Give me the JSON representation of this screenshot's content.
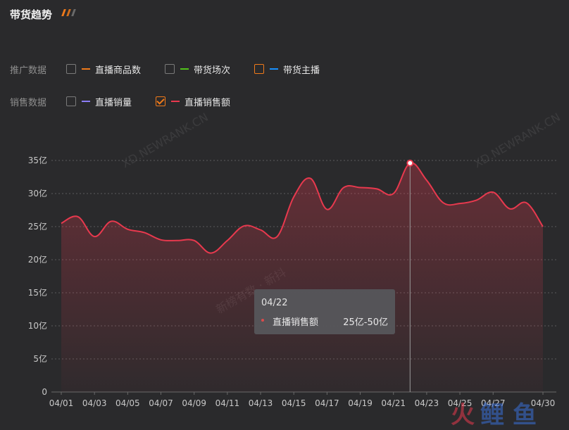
{
  "header": {
    "title": "带货趋势"
  },
  "filters": {
    "rows": [
      {
        "label": "推广数据",
        "options": [
          {
            "text": "直播商品数",
            "checked": false,
            "color": "#f07a1a"
          },
          {
            "text": "带货场次",
            "checked": false,
            "color": "#52c41a"
          },
          {
            "text": "带货主播",
            "checked": false,
            "color": "#1890ff",
            "highlight": true
          }
        ]
      },
      {
        "label": "销售数据",
        "options": [
          {
            "text": "直播销量",
            "checked": false,
            "color": "#8b7cf6"
          },
          {
            "text": "直播销售额",
            "checked": true,
            "color": "#e8394e"
          }
        ]
      }
    ]
  },
  "watermarks": [
    "XD.NEWRANK.CN",
    "XD.NEWRANK.CN",
    "新榜有数 · 新抖"
  ],
  "tooltip": {
    "date": "04/22",
    "series": "直播销售额",
    "value": "25亿-50亿"
  },
  "brand": {
    "chars": [
      "火",
      "鲤",
      "鱼"
    ]
  },
  "chart_data": {
    "type": "area",
    "series": [
      {
        "name": "直播销售额",
        "color": "#e8394e"
      }
    ],
    "x": [
      "04/01",
      "04/02",
      "04/03",
      "04/04",
      "04/05",
      "04/06",
      "04/07",
      "04/08",
      "04/09",
      "04/10",
      "04/11",
      "04/12",
      "04/13",
      "04/14",
      "04/15",
      "04/16",
      "04/17",
      "04/18",
      "04/19",
      "04/20",
      "04/21",
      "04/22",
      "04/23",
      "04/24",
      "04/25",
      "04/26",
      "04/27",
      "04/28",
      "04/29",
      "04/30"
    ],
    "values": [
      25.5,
      26.5,
      23.5,
      25.8,
      24.6,
      24.1,
      23.0,
      22.9,
      22.9,
      21.0,
      22.9,
      25.1,
      24.5,
      23.5,
      29.5,
      32.3,
      27.6,
      30.9,
      30.9,
      30.7,
      30.0,
      34.6,
      32.0,
      28.6,
      28.5,
      29.0,
      30.2,
      27.7,
      28.6,
      25.0
    ],
    "x_tick_labels": [
      "04/01",
      "04/03",
      "04/05",
      "04/07",
      "04/09",
      "04/11",
      "04/13",
      "04/15",
      "04/17",
      "04/19",
      "04/21",
      "04/23",
      "04/25",
      "04/27",
      "04/30"
    ],
    "y_tick_labels": [
      "0",
      "5亿",
      "10亿",
      "15亿",
      "20亿",
      "25亿",
      "30亿",
      "35亿"
    ],
    "y_ticks": [
      0,
      5,
      10,
      15,
      20,
      25,
      30,
      35
    ],
    "ylim": [
      0,
      35
    ],
    "highlight_index": 21,
    "grid": true
  }
}
